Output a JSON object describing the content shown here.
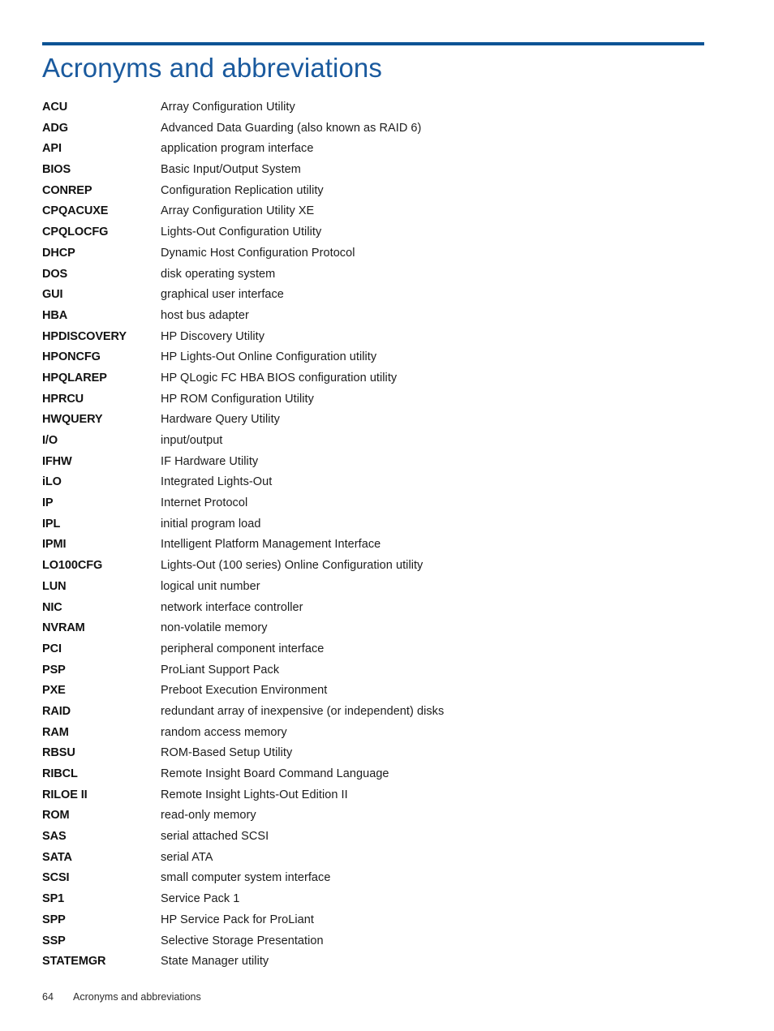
{
  "document": {
    "title": "Acronyms and abbreviations",
    "accent_rule_color": "#0b5394",
    "title_color": "#1a5a9e"
  },
  "footer": {
    "page_number": "64",
    "section_label": "Acronyms and abbreviations"
  },
  "glossary": {
    "entries": [
      {
        "term": "ACU",
        "definition": "Array Configuration Utility"
      },
      {
        "term": "ADG",
        "definition": "Advanced Data Guarding (also known as RAID 6)"
      },
      {
        "term": "API",
        "definition": "application program interface"
      },
      {
        "term": "BIOS",
        "definition": "Basic Input/Output System"
      },
      {
        "term": "CONREP",
        "definition": "Configuration Replication utility"
      },
      {
        "term": "CPQACUXE",
        "definition": "Array Configuration Utility XE"
      },
      {
        "term": "CPQLOCFG",
        "definition": "Lights-Out Configuration Utility"
      },
      {
        "term": "DHCP",
        "definition": "Dynamic Host Configuration Protocol"
      },
      {
        "term": "DOS",
        "definition": "disk operating system"
      },
      {
        "term": "GUI",
        "definition": "graphical user interface"
      },
      {
        "term": "HBA",
        "definition": "host bus adapter"
      },
      {
        "term": "HPDISCOVERY",
        "definition": "HP Discovery Utility"
      },
      {
        "term": "HPONCFG",
        "definition": "HP Lights-Out Online Configuration utility"
      },
      {
        "term": "HPQLAREP",
        "definition": "HP QLogic FC HBA BIOS configuration utility"
      },
      {
        "term": "HPRCU",
        "definition": "HP ROM Configuration Utility"
      },
      {
        "term": "HWQUERY",
        "definition": "Hardware Query Utility"
      },
      {
        "term": "I/O",
        "definition": "input/output"
      },
      {
        "term": "IFHW",
        "definition": "IF Hardware Utility"
      },
      {
        "term": "iLO",
        "definition": "Integrated Lights-Out"
      },
      {
        "term": "IP",
        "definition": "Internet Protocol"
      },
      {
        "term": "IPL",
        "definition": "initial program load"
      },
      {
        "term": "IPMI",
        "definition": "Intelligent Platform Management Interface"
      },
      {
        "term": "LO100CFG",
        "definition": "Lights-Out (100 series) Online Configuration utility"
      },
      {
        "term": "LUN",
        "definition": "logical unit number"
      },
      {
        "term": "NIC",
        "definition": "network interface controller"
      },
      {
        "term": "NVRAM",
        "definition": "non-volatile memory"
      },
      {
        "term": "PCI",
        "definition": "peripheral component interface"
      },
      {
        "term": "PSP",
        "definition": "ProLiant Support Pack"
      },
      {
        "term": "PXE",
        "definition": "Preboot Execution Environment"
      },
      {
        "term": "RAID",
        "definition": "redundant array of inexpensive (or independent) disks"
      },
      {
        "term": "RAM",
        "definition": "random access memory"
      },
      {
        "term": "RBSU",
        "definition": "ROM-Based Setup Utility"
      },
      {
        "term": "RIBCL",
        "definition": "Remote Insight Board Command Language"
      },
      {
        "term": "RILOE II",
        "definition": "Remote Insight Lights-Out Edition II"
      },
      {
        "term": "ROM",
        "definition": "read-only memory"
      },
      {
        "term": "SAS",
        "definition": "serial attached SCSI"
      },
      {
        "term": "SATA",
        "definition": "serial ATA"
      },
      {
        "term": "SCSI",
        "definition": "small computer system interface"
      },
      {
        "term": "SP1",
        "definition": "Service Pack 1"
      },
      {
        "term": "SPP",
        "definition": "HP Service Pack for ProLiant"
      },
      {
        "term": "SSP",
        "definition": "Selective Storage Presentation"
      },
      {
        "term": "STATEMGR",
        "definition": "State Manager utility"
      }
    ]
  }
}
